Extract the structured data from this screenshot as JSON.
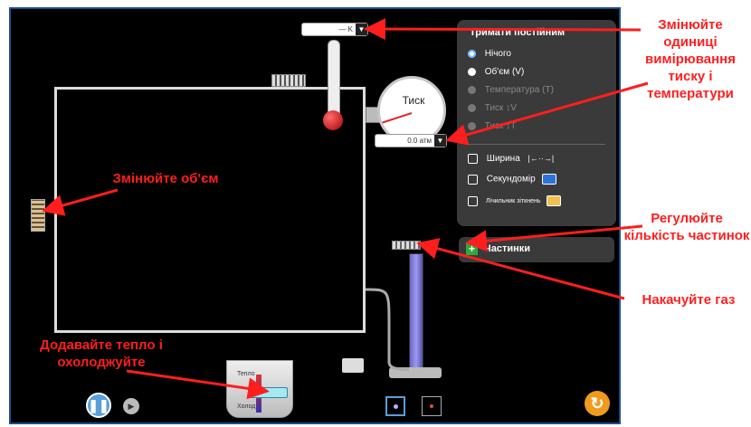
{
  "panel": {
    "title": "Тримати постійним",
    "options": [
      {
        "label": "Нічого",
        "state": "selected"
      },
      {
        "label": "Об'єм (V)",
        "state": "enabled"
      },
      {
        "label": "Температура (T)",
        "state": "disabled"
      },
      {
        "label": "Тиск ↕V",
        "state": "disabled"
      },
      {
        "label": "Тиск ↕T",
        "state": "disabled"
      }
    ],
    "checkboxes": [
      {
        "label": "Ширина",
        "icon": "ruler-icon"
      },
      {
        "label": "Секундомір",
        "icon": "stopwatch-icon"
      },
      {
        "label": "Лічильник зіткнень",
        "icon": "counter-icon"
      }
    ]
  },
  "particles_label": "Частинки",
  "gauge": {
    "label": "Тиск",
    "value": "0.0 атм"
  },
  "thermometer": {
    "value": "— K"
  },
  "bucket": {
    "top_label": "Тепло",
    "bottom_label": "Холод"
  },
  "annotations": {
    "units": "Змінюйте одиниці вимірювання тиску і температури",
    "volume": "Змінюйте об'єм",
    "particles": "Регулюйте кількість частинок",
    "pump": "Накачуйте газ",
    "heat": "Додавайте тепло і охолоджуйте"
  },
  "colors": {
    "annotation": "#ff1e1e",
    "panel_bg": "#3a3a3a",
    "sim_bg": "#000000",
    "frame": "#1b4f8e"
  }
}
